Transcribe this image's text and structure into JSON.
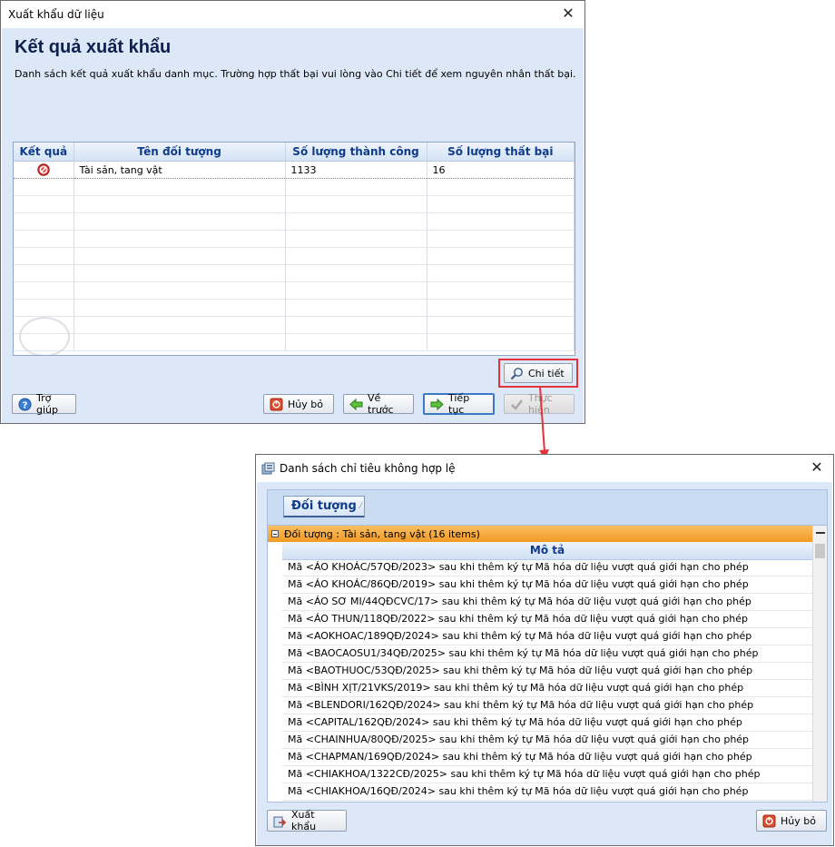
{
  "dialog1": {
    "title": "Xuất khẩu dữ liệu",
    "heading": "Kết quả xuất khẩu",
    "description": "Danh sách kết quả xuất khẩu danh mục. Trường hợp thất bại vui lòng vào Chi tiết để xem nguyên nhân thất bại.",
    "columns": [
      "Kết quả",
      "Tên đối tượng",
      "Số lượng thành công",
      "Số lượng thất bại"
    ],
    "rows": [
      {
        "name": "Tài sản, tang vật",
        "success": "1133",
        "failed": "16"
      }
    ],
    "buttons": {
      "detail": "Chi tiết",
      "help": "Trợ giúp",
      "cancel": "Hủy bỏ",
      "back": "Về trước",
      "next": "Tiếp tục",
      "execute": "Thực hiện"
    }
  },
  "dialog2": {
    "title": "Danh sách chỉ tiêu không hợp lệ",
    "group_chip": "Đối tượng",
    "group_row": "Đối tượng : Tài sản, tang vật (16 items)",
    "column": "Mô tả",
    "items": [
      "Mã <ÁO KHOÁC/57QĐ/2023> sau khi thêm ký tự Mã hóa dữ liệu vượt quá giới hạn cho phép",
      "Mã <ÁO KHOÁC/86QĐ/2019> sau khi thêm ký tự Mã hóa dữ liệu vượt quá giới hạn cho phép",
      "Mã <ÁO SƠ MI/44QĐCVC/17> sau khi thêm ký tự Mã hóa dữ liệu vượt quá giới hạn cho phép",
      "Mã <ÁO THUN/118QĐ/2022> sau khi thêm ký tự Mã hóa dữ liệu vượt quá giới hạn cho phép",
      "Mã <AOKHOAC/189QĐ/2024> sau khi thêm ký tự Mã hóa dữ liệu vượt quá giới hạn cho phép",
      "Mã <BAOCAOSU1/34QĐ/2025> sau khi thêm ký tự Mã hóa dữ liệu vượt quá giới hạn cho phép",
      "Mã <BAOTHUOC/53QĐ/2025> sau khi thêm ký tự Mã hóa dữ liệu vượt quá giới hạn cho phép",
      "Mã <BÌNH XỊT/21VKS/2019> sau khi thêm ký tự Mã hóa dữ liệu vượt quá giới hạn cho phép",
      "Mã <BLENDORI/162QĐ/2024> sau khi thêm ký tự Mã hóa dữ liệu vượt quá giới hạn cho phép",
      "Mã <CAPITAL/162QĐ/2024> sau khi thêm ký tự Mã hóa dữ liệu vượt quá giới hạn cho phép",
      "Mã <CHAINHUA/80QĐ/2025> sau khi thêm ký tự Mã hóa dữ liệu vượt quá giới hạn cho phép",
      "Mã <CHAPMAN/169QĐ/2024> sau khi thêm ký tự Mã hóa dữ liệu vượt quá giới hạn cho phép",
      "Mã <CHIAKHOA/1322CĐ/2025> sau khi thêm ký tự Mã hóa dữ liệu vượt quá giới hạn cho phép",
      "Mã <CHIAKHOA/16QĐ/2024> sau khi thêm ký tự Mã hóa dữ liệu vượt quá giới hạn cho phép"
    ],
    "buttons": {
      "export": "Xuất khẩu",
      "cancel": "Hủy bỏ"
    }
  },
  "colors": {
    "client_bg": "#dce8f8",
    "heading_text": "#0f1f4f",
    "group_row_bg": "#f5a33b",
    "highlight_box": "#e5323b",
    "header_text": "#0f3b8c"
  }
}
